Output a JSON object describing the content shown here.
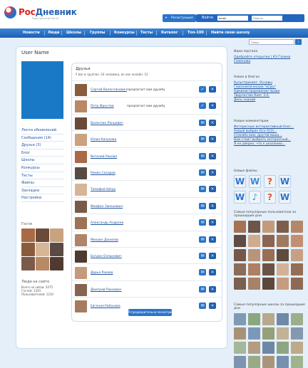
{
  "header": {
    "logo_part1": "Рос",
    "logo_part2": "Дневник",
    "slogan": "Пространство Роста",
    "register": "Регистрация",
    "login_label": "Войти",
    "login_value": "email",
    "password_placeholder": "Пароль"
  },
  "nav": [
    "Новости",
    "Люди",
    "Школы",
    "Группы",
    "Конкурсы",
    "Тесты",
    "Каталог",
    "Топ-100",
    "Найти свою школу"
  ],
  "search": {
    "placeholder": "Поиск"
  },
  "profile": {
    "username": "User Name"
  },
  "left_menu": [
    "Лента обновлений",
    "Сообщения (14)",
    "Друзья (3)",
    "Блог",
    "Школы",
    "Конкурсы",
    "Тесты",
    "Файлы",
    "Закладки",
    "Настройки"
  ],
  "guests": {
    "title": "Гости"
  },
  "online": {
    "title": "Люди на сайте",
    "lines": [
      "Всего на связи: 2475",
      "Гостей: 1245",
      "Пользователей: 1210"
    ]
  },
  "friends": {
    "title": "Друзья",
    "subtitle": "У вас в группах: 24 человека, из них онлайн: 12",
    "request_text": "предлагает вам дружбу",
    "more_button": "Я предварительно посмотрю",
    "items": [
      {
        "name": "Сергей Валентинович",
        "request": true
      },
      {
        "name": "Петр Фронтов",
        "request": true
      },
      {
        "name": "Валентин Ранцевич",
        "request": false
      },
      {
        "name": "Юлия Капукова",
        "request": false
      },
      {
        "name": "Виталий Ракова",
        "request": false
      },
      {
        "name": "Роман Сахаров",
        "request": false
      },
      {
        "name": "Тимофей Шпур",
        "request": false
      },
      {
        "name": "Феофан Зюнькович",
        "request": false
      },
      {
        "name": "Александр Андреев",
        "request": false
      },
      {
        "name": "Михаил Данилов",
        "request": false
      },
      {
        "name": "Богдан Охлыкович",
        "request": false
      },
      {
        "name": "Дарья Ракова",
        "request": false
      },
      {
        "name": "Дмитрий Ракеевич",
        "request": false
      },
      {
        "name": "Евгения Рабанова",
        "request": false
      }
    ]
  },
  "right": {
    "portal_title": "Идеи портала",
    "portal_link": "Одобряйте открытки | КЭ Галина Семенова",
    "blogs_title": "Новое в блогах",
    "blog_links": [
      "Культпросвет. Основы",
      "Геополитические \"игры\"",
      "Администрирование права",
      "Творчество Кинг З.А.",
      "День знаний"
    ],
    "comments_title": "Новые комментарии",
    "comment_links": [
      "Интересные интерактивный блог...",
      "Новый выбран Осн О(3)...",
      "Спасибо вам, другой ваша...",
      "Вам стоит выбрать интересный...",
      "Я не уверен, что к указанию..."
    ],
    "files_title": "Новые файлы",
    "users_title": "Самые популярные пользователи за прошедшие дни",
    "schools_title": "Самые популярные школы за прошедшие дни"
  },
  "colors": {
    "accent": "#2b74c9",
    "nav": "#1d5fb3",
    "link": "#23569e",
    "background": "#e4eff9",
    "logo_red": "#dd2222"
  }
}
